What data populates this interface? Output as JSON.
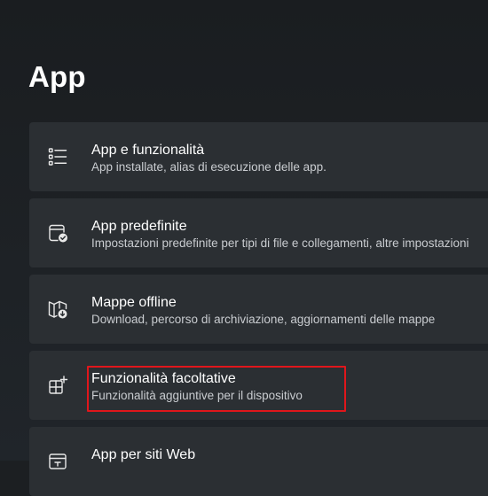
{
  "page": {
    "title": "App"
  },
  "items": [
    {
      "icon": "app-list-icon",
      "title": "App e funzionalità",
      "subtitle": "App installate, alias di esecuzione delle app."
    },
    {
      "icon": "default-apps-icon",
      "title": "App predefinite",
      "subtitle": "Impostazioni predefinite per tipi di file e collegamenti, altre impostazioni"
    },
    {
      "icon": "offline-map-icon",
      "title": "Mappe offline",
      "subtitle": "Download, percorso di archiviazione, aggiornamenti delle mappe"
    },
    {
      "icon": "optional-features-icon",
      "title": "Funzionalità facoltative",
      "subtitle": "Funzionalità aggiuntive per il dispositivo"
    },
    {
      "icon": "apps-for-websites-icon",
      "title": "App per siti Web",
      "subtitle": ""
    }
  ],
  "colors": {
    "background": "#1c1f22",
    "card": "#2b2f33",
    "highlight": "#e0161b",
    "text_primary": "#ffffff",
    "text_secondary": "#c9ccd0"
  }
}
